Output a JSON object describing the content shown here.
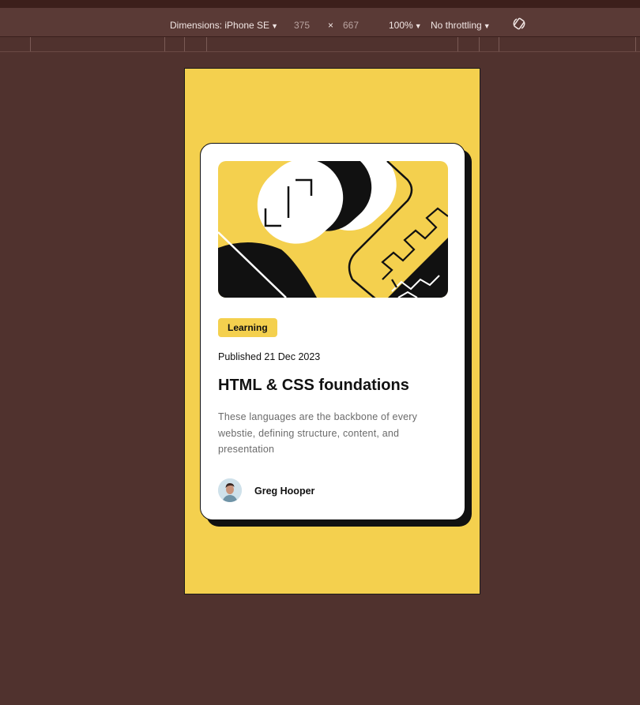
{
  "devtools": {
    "device_label": "Dimensions: iPhone SE",
    "width_value": "375",
    "times_symbol": "×",
    "height_value": "667",
    "zoom_label": "100%",
    "throttle_label": "No throttling",
    "rotate_icon": "rotate-icon"
  },
  "card": {
    "tag": "Learning",
    "published": "Published 21 Dec 2023",
    "title": "HTML & CSS foundations",
    "description": "These languages are the backbone of every webstie, defining structure, content, and presentation",
    "author": "Greg Hooper"
  },
  "colors": {
    "page_background": "#50322e",
    "viewport_background": "#f4d04e",
    "card_background": "#ffffff",
    "ink": "#111111",
    "muted_text": "#6b6b6b"
  }
}
